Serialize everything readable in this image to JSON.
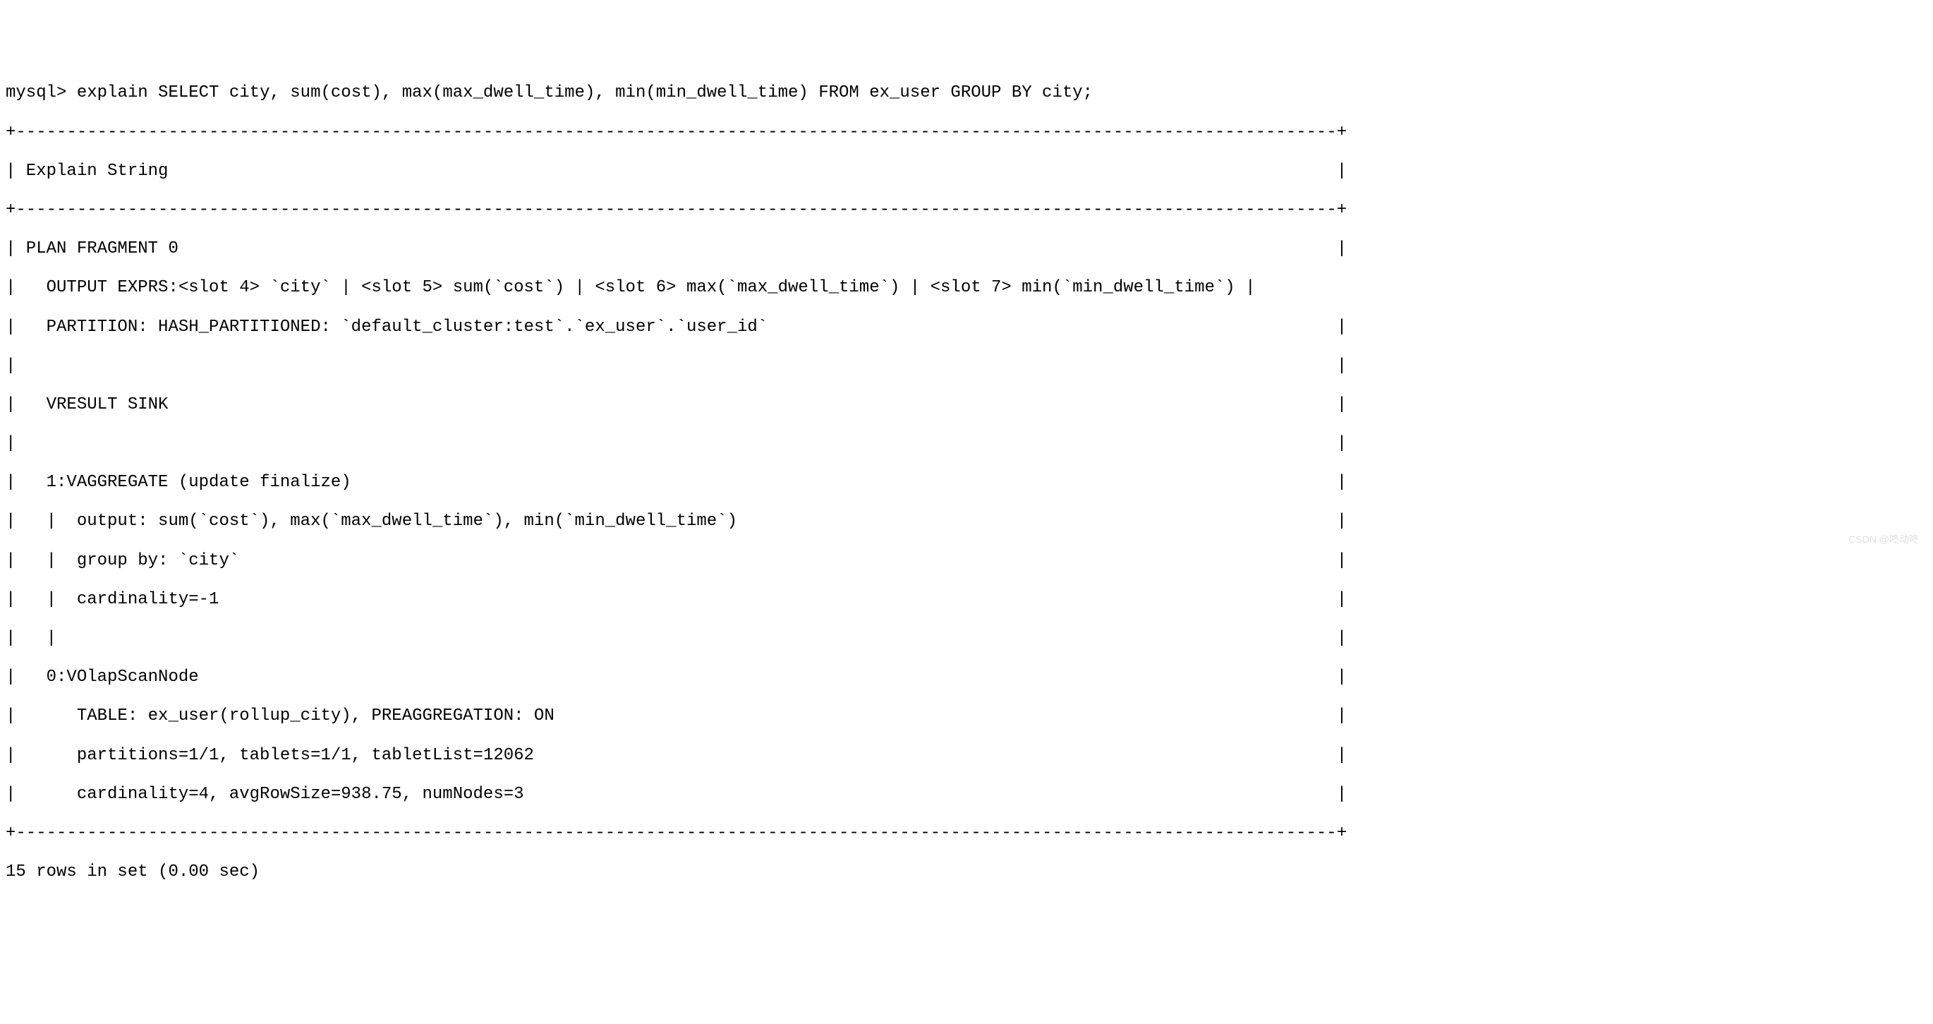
{
  "terminal": {
    "prompt": "mysql> ",
    "command": "explain SELECT city, sum(cost), max(max_dwell_time), min(min_dwell_time) FROM ex_user GROUP BY city;",
    "sep_top": "+----------------------------------------------------------------------------------------------------------------------------------+",
    "header_row": "| Explain String                                                                                                                   |",
    "sep_mid": "+----------------------------------------------------------------------------------------------------------------------------------+",
    "plan_lines": [
      "| PLAN FRAGMENT 0                                                                                                                  |",
      "|   OUTPUT EXPRS:<slot 4> `city` | <slot 5> sum(`cost`) | <slot 6> max(`max_dwell_time`) | <slot 7> min(`min_dwell_time`) |",
      "|   PARTITION: HASH_PARTITIONED: `default_cluster:test`.`ex_user`.`user_id`                                                        |",
      "|                                                                                                                                  |",
      "|   VRESULT SINK                                                                                                                   |",
      "|                                                                                                                                  |",
      "|   1:VAGGREGATE (update finalize)                                                                                                 |",
      "|   |  output: sum(`cost`), max(`max_dwell_time`), min(`min_dwell_time`)                                                           |",
      "|   |  group by: `city`                                                                                                            |",
      "|   |  cardinality=-1                                                                                                              |",
      "|   |                                                                                                                              |",
      "|   0:VOlapScanNode                                                                                                                |",
      "|      TABLE: ex_user(rollup_city), PREAGGREGATION: ON                                                                             |",
      "|      partitions=1/1, tablets=1/1, tabletList=12062                                                                               |",
      "|      cardinality=4, avgRowSize=938.75, numNodes=3                                                                                |"
    ],
    "sep_bot": "+----------------------------------------------------------------------------------------------------------------------------------+",
    "footer": "15 rows in set (0.00 sec)"
  },
  "watermark": "CSDN @咚动咚"
}
